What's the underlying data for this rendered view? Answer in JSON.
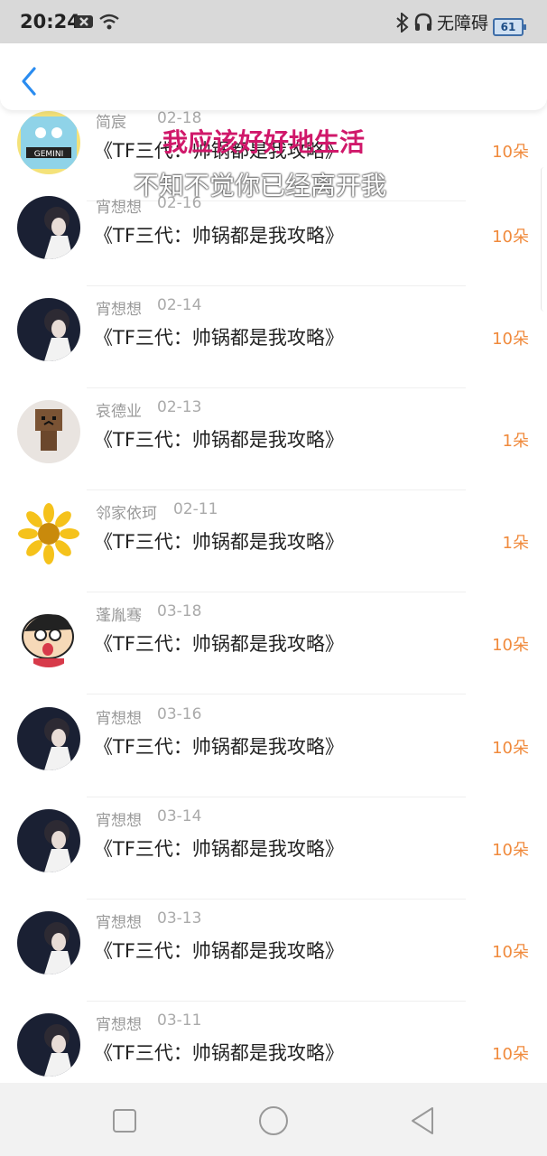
{
  "status_bar": {
    "time": "20:24",
    "icons": [
      "close-box-icon",
      "wifi-icon",
      "bluetooth-icon",
      "headset-icon"
    ],
    "accessibility_label": "无障碍",
    "battery": "61"
  },
  "header": {
    "back_icon": "chevron-left-icon",
    "accent_color": "#2a8cf0"
  },
  "lyrics": {
    "line1": "我应该好好地生活",
    "line2": "不知不觉你已经离开我"
  },
  "rows": [
    {
      "name": "简宸",
      "date": "02-18",
      "title": "《TF三代：帅锅都是我攻略》",
      "count": "10朵",
      "avatar": "gemini-cartoon"
    },
    {
      "name": "宵想想",
      "date": "02-16",
      "title": "《TF三代：帅锅都是我攻略》",
      "count": "10朵",
      "avatar": "dark-boy"
    },
    {
      "name": "宵想想",
      "date": "02-14",
      "title": "《TF三代：帅锅都是我攻略》",
      "count": "10朵",
      "avatar": "dark-boy"
    },
    {
      "name": "哀德业",
      "date": "02-13",
      "title": "《TF三代：帅锅都是我攻略》",
      "count": "1朵",
      "avatar": "danbo-box"
    },
    {
      "name": "邻家依珂",
      "date": "02-11",
      "title": "《TF三代：帅锅都是我攻略》",
      "count": "1朵",
      "avatar": "sunflower"
    },
    {
      "name": "蓬胤骞",
      "date": "03-18",
      "title": "《TF三代：帅锅都是我攻略》",
      "count": "10朵",
      "avatar": "crayon-kid"
    },
    {
      "name": "宵想想",
      "date": "03-16",
      "title": "《TF三代：帅锅都是我攻略》",
      "count": "10朵",
      "avatar": "dark-boy"
    },
    {
      "name": "宵想想",
      "date": "03-14",
      "title": "《TF三代：帅锅都是我攻略》",
      "count": "10朵",
      "avatar": "dark-boy"
    },
    {
      "name": "宵想想",
      "date": "03-13",
      "title": "《TF三代：帅锅都是我攻略》",
      "count": "10朵",
      "avatar": "dark-boy"
    },
    {
      "name": "宵想想",
      "date": "03-11",
      "title": "《TF三代：帅锅都是我攻略》",
      "count": "10朵",
      "avatar": "dark-boy"
    }
  ],
  "nav_bar": {
    "icons": [
      "recents-square-icon",
      "home-circle-icon",
      "back-triangle-icon"
    ]
  },
  "colors": {
    "count": "#f08a3c",
    "lyric_highlight": "#d0186a",
    "status_bar": "#d9d9d9"
  }
}
